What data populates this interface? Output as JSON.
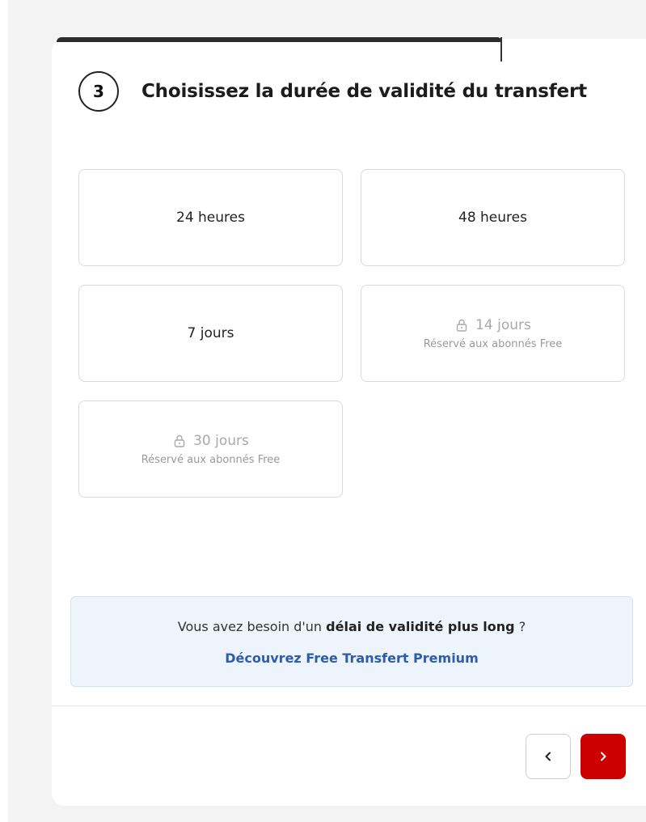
{
  "step": {
    "number": "3",
    "title": "Choisissez la durée de validité du transfert"
  },
  "options": [
    {
      "label": "24 heures",
      "locked": false
    },
    {
      "label": "48 heures",
      "locked": false
    },
    {
      "label": "7 jours",
      "locked": false
    },
    {
      "label": "14 jours",
      "locked": true,
      "note": "Réservé aux abonnés Free",
      "icon": "lock-icon"
    },
    {
      "label": "30 jours",
      "locked": true,
      "note": "Réservé aux abonnés Free",
      "icon": "lock-icon"
    }
  ],
  "premium": {
    "text_before": "Vous avez besoin d'un ",
    "text_bold": "délai de validité plus long",
    "text_after": " ?",
    "link": "Découvrez Free Transfert Premium"
  },
  "navigation": {
    "prev_icon": "chevron-left-icon",
    "next_icon": "chevron-right-icon"
  },
  "colors": {
    "accent_red": "#cc0000",
    "link_blue": "#2d5cab",
    "premium_bg": "#edf4fc"
  }
}
